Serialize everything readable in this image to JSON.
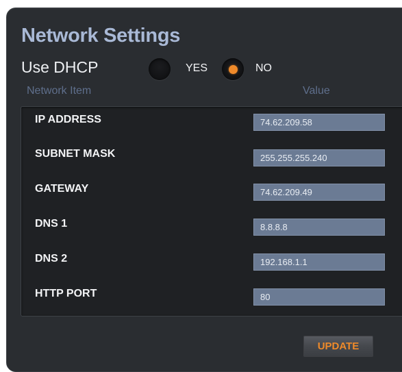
{
  "title": "Network Settings",
  "dhcp": {
    "label": "Use DHCP",
    "options": [
      {
        "label": "YES",
        "selected": false
      },
      {
        "label": "NO",
        "selected": true
      }
    ]
  },
  "table": {
    "columns": [
      "Network Item",
      "Value"
    ],
    "rows": [
      {
        "label": "IP ADDRESS",
        "value": "74.62.209.58"
      },
      {
        "label": "SUBNET MASK",
        "value": "255.255.255.240"
      },
      {
        "label": "GATEWAY",
        "value": "74.62.209.49"
      },
      {
        "label": "DNS 1",
        "value": "8.8.8.8"
      },
      {
        "label": "DNS 2",
        "value": "192.168.1.1"
      },
      {
        "label": "HTTP PORT",
        "value": "80"
      }
    ]
  },
  "update_label": "UPDATE",
  "colors": {
    "accent": "#ef8a2a",
    "title": "#a9b9d6",
    "panel": "#2a2d31",
    "input": "#6b7b94"
  }
}
